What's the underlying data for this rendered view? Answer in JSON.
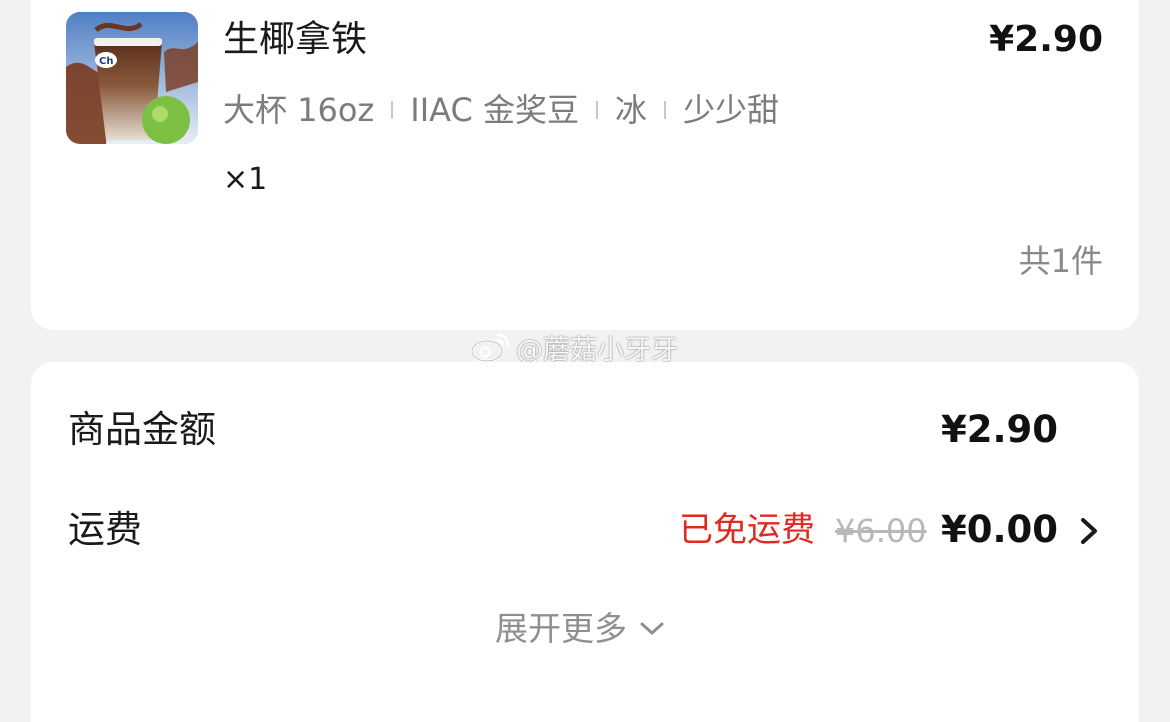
{
  "order_item": {
    "name": "生椰拿铁",
    "price": "¥2.90",
    "specs": [
      "大杯 16oz",
      "IIAC 金奖豆",
      "冰",
      "少少甜"
    ],
    "quantity": "×1",
    "total_count": "共1件",
    "image_icon": "coconut-latte-product-image"
  },
  "summary": {
    "subtotal_label": "商品金额",
    "subtotal_value": "¥2.90",
    "shipping_label": "运费",
    "shipping_free_label": "已免运费",
    "shipping_original": "¥6.00",
    "shipping_value": "¥0.00",
    "expand_label": "展开更多"
  },
  "watermark": {
    "text": "@蘑菇小牙牙",
    "icon": "weibo-icon"
  },
  "colors": {
    "background": "#f2f2f2",
    "card": "#ffffff",
    "free_shipping_red": "#e0291f",
    "muted_text": "#7c7c7c"
  }
}
